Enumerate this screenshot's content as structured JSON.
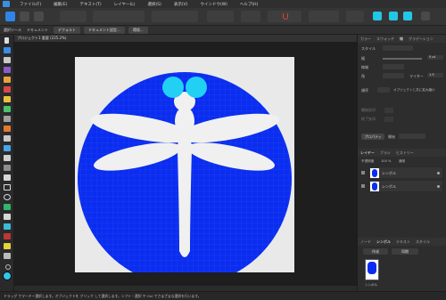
{
  "menu": {
    "items": [
      "ファイル(F)",
      "編集(E)",
      "テキスト(T)",
      "レイヤー(L)",
      "選択(S)",
      "表示(V)",
      "ウインドウ(W)",
      "ヘルプ(H)"
    ]
  },
  "contextbar": {
    "label_tool": "選択ツール",
    "label_unit": "ドキュメント",
    "unit_value": "デフォルト",
    "btn_doc_settings": "ドキュメント設定...",
    "btn_prefs": "環境..."
  },
  "document": {
    "tab_title": "プロジェクト1 重要 (225.2%)"
  },
  "canvas": {
    "circle_color": "#0a2df0",
    "eye_color": "#21d0f2",
    "body_color": "#f0f0f0"
  },
  "right_panel": {
    "top_tabs": [
      "カラー",
      "スウォッチ",
      "線",
      "グラデーション"
    ],
    "stroke_label": "スタイル",
    "width_label": "幅",
    "width_value": "0 pt",
    "cap_label": "線端",
    "join_label": "角",
    "miter_label": "マイター",
    "miter_value": "1.5",
    "order_label": "順序",
    "scale_label": "オブジェクトと共に拡大縮小",
    "arrow_start_label": "開始矢印",
    "arrow_end_label": "終了矢印",
    "pressure_label": "筆圧",
    "pressure_btn": "プロパティ",
    "pressure_btn2": "開始",
    "layers_tabs": [
      "レイヤー",
      "ブラシ",
      "ヒストリー"
    ],
    "opacity_label": "不透明度",
    "opacity_value": "100 %",
    "blend_value": "通常",
    "layers": [
      {
        "name": "シンボル"
      },
      {
        "name": "シンボル"
      }
    ],
    "assets_tabs": [
      "ノード",
      "シンボル",
      "テキスト",
      "スタイル"
    ],
    "btn_create": "作成",
    "btn_sync": "同期",
    "symbol_name": "シンボル"
  },
  "status": {
    "text": "ドラッグ でマーキー選択します。オブジェクトを クリック して選択します。シフト・選択 や Ctrl でさまざまな選択を行います。"
  }
}
